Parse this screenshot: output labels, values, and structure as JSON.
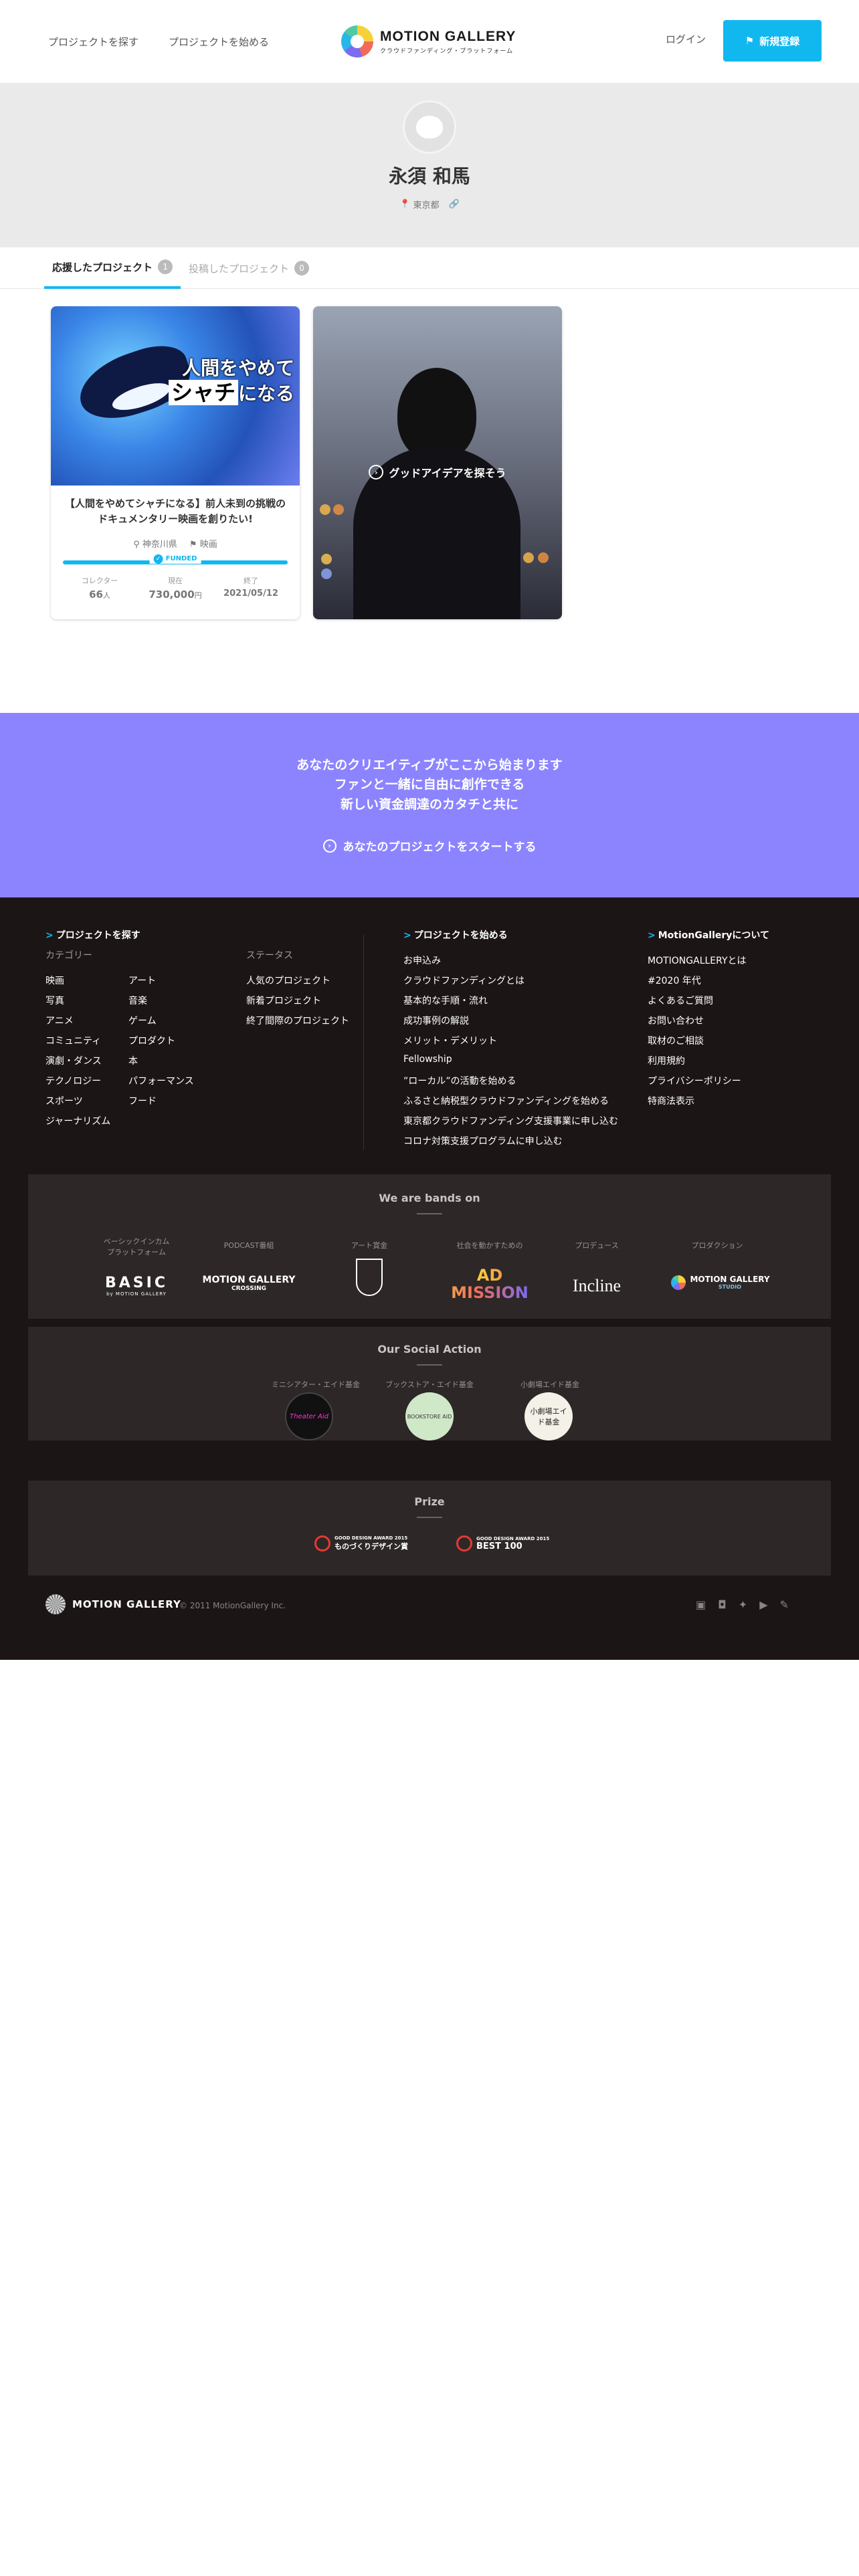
{
  "header": {
    "nav_find": "プロジェクトを探す",
    "nav_start": "プロジェクトを始める",
    "logo_title": "MOTION GALLERY",
    "logo_sub": "クラウドファンディング・プラットフォーム",
    "login": "ログイン",
    "signup": "新規登録"
  },
  "profile": {
    "name": "永須 和馬",
    "location": "東京都"
  },
  "tabs": [
    {
      "label": "応援したプロジェクト",
      "count": "1"
    },
    {
      "label": "投稿したプロジェクト",
      "count": "0"
    }
  ],
  "card1": {
    "thumb_line1": "人間をやめて",
    "thumb_line2": "シャチ",
    "thumb_line2b": "になる",
    "title": "【人間をやめてシャチになる】前人未到の挑戦のドキュメンタリー映画を創りたい!",
    "pref": "神奈川県",
    "category": "映画",
    "funded": "FUNDED",
    "collector_label": "コレクター",
    "collector_value": "66",
    "collector_unit": "人",
    "raised_label": "現在",
    "raised_value": "730,000",
    "raised_unit": "円",
    "end_label": "終了",
    "end_value": "2021/05/12"
  },
  "card2": {
    "cta": "グッドアイデアを探そう"
  },
  "promo": {
    "line1": "あなたのクリエイティブがここから始まります",
    "line2": "ファンと一緒に自由に創作できる",
    "line3": "新しい資金調達のカタチと共に",
    "start": "あなたのプロジェクトをスタートする"
  },
  "footer": {
    "find_title": "プロジェクトを探す",
    "category_label": "カテゴリー",
    "categories_left": [
      "映画",
      "写真",
      "アニメ",
      "コミュニティ",
      "演劇・ダンス",
      "テクノロジー",
      "スポーツ",
      "ジャーナリズム"
    ],
    "categories_right": [
      "アート",
      "音楽",
      "ゲーム",
      "プロダクト",
      "本",
      "パフォーマンス",
      "フード"
    ],
    "status_label": "ステータス",
    "status_items": [
      "人気のプロジェクト",
      "新着プロジェクト",
      "終了間際のプロジェクト"
    ],
    "start_title": "プロジェクトを始める",
    "start_items": [
      "お申込み",
      "クラウドファンディングとは",
      "基本的な手順・流れ",
      "成功事例の解説",
      "メリット・デメリット",
      "Fellowship",
      "”ローカル”の活動を始める",
      "ふるさと納税型クラウドファンディングを始める",
      "東京都クラウドファンディング支援事業に申し込む",
      "コロナ対策支援プログラムに申し込む"
    ],
    "about_title": "MotionGalleryについて",
    "about_items": [
      "MOTIONGALLERYとは",
      "#2020 年代",
      "よくあるご質問",
      "お問い合わせ",
      "取材のご相談",
      "利用規約",
      "プライバシーポリシー",
      "特商法表示"
    ],
    "bands_title": "We are bands on",
    "bands": [
      {
        "caption": "ベーシックインカム\nプラットフォーム",
        "logo": "BASIC",
        "logo_sub": "by MOTION GALLERY"
      },
      {
        "caption": "PODCAST番組",
        "logo": "MOTION GALLERY",
        "logo_sub": "CROSSING"
      },
      {
        "caption": "アート賞金",
        "logo": "",
        "logo_sub": ""
      },
      {
        "caption": "社会を動かすための",
        "logo": "AD MISSION",
        "logo_sub": ""
      },
      {
        "caption": "プロデュース",
        "logo": "Incline",
        "logo_sub": ""
      },
      {
        "caption": "プロダクション",
        "logo": "MOTION GALLERY",
        "logo_sub": "STUDIO"
      }
    ],
    "social_title": "Our Social Action",
    "social": [
      {
        "caption": "ミニシアター・エイド基金",
        "logo": "Theater Aid"
      },
      {
        "caption": "ブックストア・エイド基金",
        "logo": "BOOKSTORE AID"
      },
      {
        "caption": "小劇場エイド基金",
        "logo": "小劇場エイド基金"
      }
    ],
    "prize_title": "Prize",
    "prize": [
      {
        "line1": "GOOD DESIGN AWARD 2015",
        "line2": "ものづくりデザイン賞"
      },
      {
        "line1": "GOOD DESIGN AWARD 2015",
        "line2": "BEST 100"
      }
    ],
    "logo_text": "MOTION GALLERY",
    "copyright": "© 2011 MotionGallery Inc."
  }
}
